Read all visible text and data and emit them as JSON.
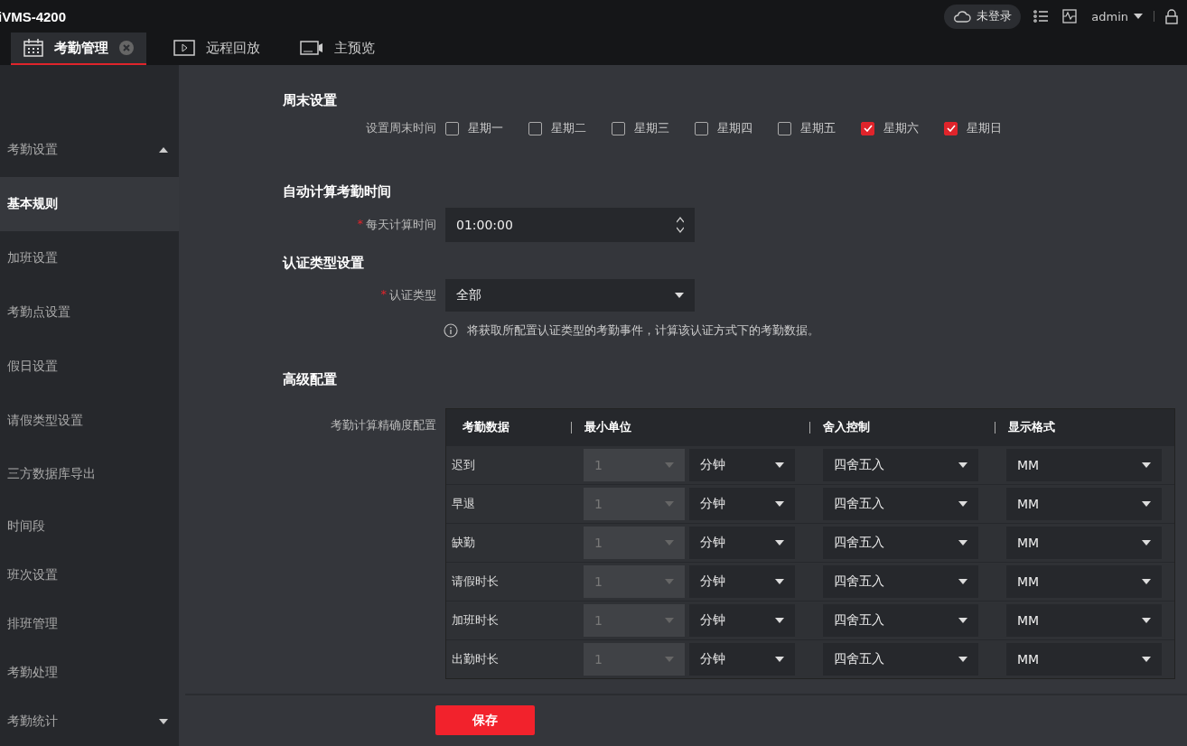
{
  "app": {
    "title": "iVMS-4200",
    "cloud_status": "未登录",
    "user": "admin"
  },
  "tabs": [
    {
      "label": "考勤管理",
      "kind": "calendar",
      "selected": true,
      "closable": true
    },
    {
      "label": "远程回放",
      "kind": "play",
      "selected": false,
      "closable": false
    },
    {
      "label": "主预览",
      "kind": "camera",
      "selected": false,
      "closable": false
    }
  ],
  "sidebar": {
    "items": [
      {
        "kind": "group",
        "label": "考勤设置",
        "expanded": true
      },
      {
        "kind": "item",
        "label": "基本规则",
        "selected": true
      },
      {
        "kind": "item",
        "label": "加班设置",
        "selected": false
      },
      {
        "kind": "item",
        "label": "考勤点设置",
        "selected": false
      },
      {
        "kind": "item",
        "label": "假日设置",
        "selected": false
      },
      {
        "kind": "item",
        "label": "请假类型设置",
        "selected": false
      },
      {
        "kind": "item",
        "label": "三方数据库导出",
        "selected": false
      },
      {
        "kind": "item",
        "label": "时间段",
        "selected": false
      },
      {
        "kind": "item",
        "label": "班次设置",
        "selected": false
      },
      {
        "kind": "item",
        "label": "排班管理",
        "selected": false
      },
      {
        "kind": "item",
        "label": "考勤处理",
        "selected": false
      },
      {
        "kind": "group",
        "label": "考勤统计",
        "expanded": false
      }
    ]
  },
  "weekend": {
    "heading": "周末设置",
    "label": "设置周末时间",
    "days": [
      {
        "label": "星期一",
        "checked": false
      },
      {
        "label": "星期二",
        "checked": false
      },
      {
        "label": "星期三",
        "checked": false
      },
      {
        "label": "星期四",
        "checked": false
      },
      {
        "label": "星期五",
        "checked": false
      },
      {
        "label": "星期六",
        "checked": true
      },
      {
        "label": "星期日",
        "checked": true
      }
    ]
  },
  "auto_calc": {
    "heading": "自动计算考勤时间",
    "required_mark": "*",
    "label": "每天计算时间",
    "value": "01:00:00"
  },
  "auth_type": {
    "heading": "认证类型设置",
    "required_mark": "*",
    "label": "认证类型",
    "value": "全部",
    "hint": "将获取所配置认证类型的考勤事件，计算该认证方式下的考勤数据。"
  },
  "advanced": {
    "heading": "高级配置",
    "label": "考勤计算精确度配置",
    "table": {
      "columns": [
        "考勤数据",
        "最小单位",
        "舍入控制",
        "显示格式"
      ],
      "rows": [
        {
          "name": "迟到",
          "min_value": "1",
          "min_value_disabled": true,
          "unit": "分钟",
          "rounding": "四舍五入",
          "format": "MM"
        },
        {
          "name": "早退",
          "min_value": "1",
          "min_value_disabled": true,
          "unit": "分钟",
          "rounding": "四舍五入",
          "format": "MM"
        },
        {
          "name": "缺勤",
          "min_value": "1",
          "min_value_disabled": true,
          "unit": "分钟",
          "rounding": "四舍五入",
          "format": "MM"
        },
        {
          "name": "请假时长",
          "min_value": "1",
          "min_value_disabled": true,
          "unit": "分钟",
          "rounding": "四舍五入",
          "format": "MM"
        },
        {
          "name": "加班时长",
          "min_value": "1",
          "min_value_disabled": true,
          "unit": "分钟",
          "rounding": "四舍五入",
          "format": "MM"
        },
        {
          "name": "出勤时长",
          "min_value": "1",
          "min_value_disabled": true,
          "unit": "分钟",
          "rounding": "四舍五入",
          "format": "MM"
        }
      ]
    }
  },
  "save_button": "保存"
}
